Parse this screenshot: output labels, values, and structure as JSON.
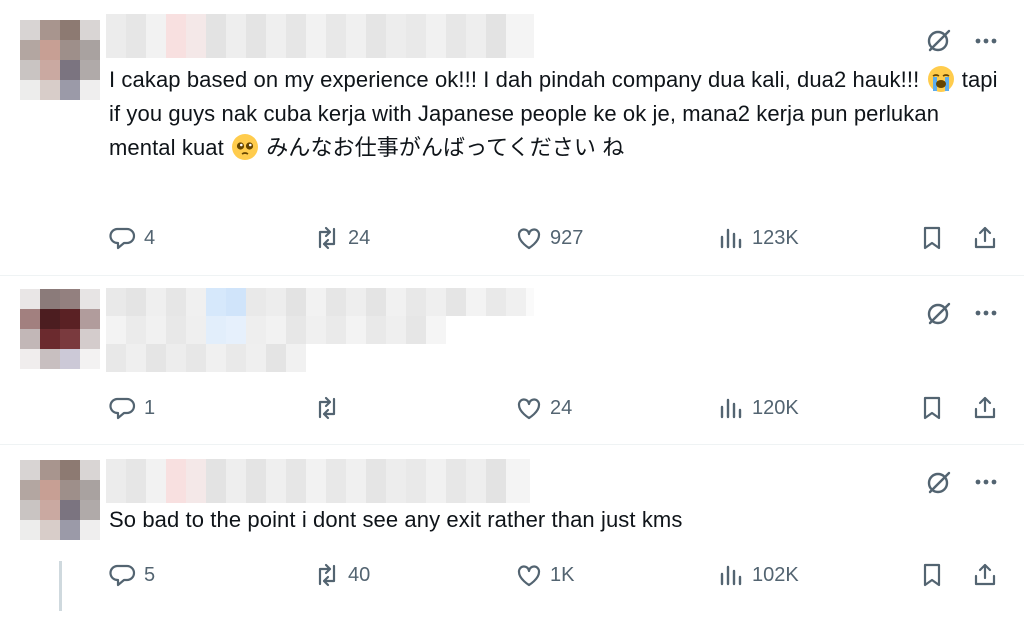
{
  "tweets": [
    {
      "text_before": "I cakap based on my experience ok!!! I dah pindah company dua kali, dua2 hauk!!! ",
      "text_middle": " tapi if you guys nak cuba kerja with Japanese people ke ok je, mana2 kerja pun perlukan mental kuat ",
      "text_after": " みんなお仕事がんばってください ね",
      "emoji_1": "loudly-crying-face-emoji",
      "emoji_2": "pleading-face-emoji",
      "replies": "4",
      "reposts": "24",
      "likes": "927",
      "views": "123K"
    },
    {
      "text": "",
      "replies": "1",
      "reposts": "",
      "likes": "24",
      "views": "120K"
    },
    {
      "text": "So bad to the point i dont see any exit rather than just kms",
      "replies": "5",
      "reposts": "40",
      "likes": "1K",
      "views": "102K"
    }
  ],
  "icons": {
    "grok": "grok-icon",
    "more": "more-icon",
    "reply": "reply-icon",
    "repost": "repost-icon",
    "like": "like-icon",
    "views": "views-icon",
    "bookmark": "bookmark-icon",
    "share": "share-icon"
  },
  "colors": {
    "text": "#0f1419",
    "secondary": "#536471",
    "divider": "#eff3f4",
    "thread_line": "#cfd9de"
  }
}
